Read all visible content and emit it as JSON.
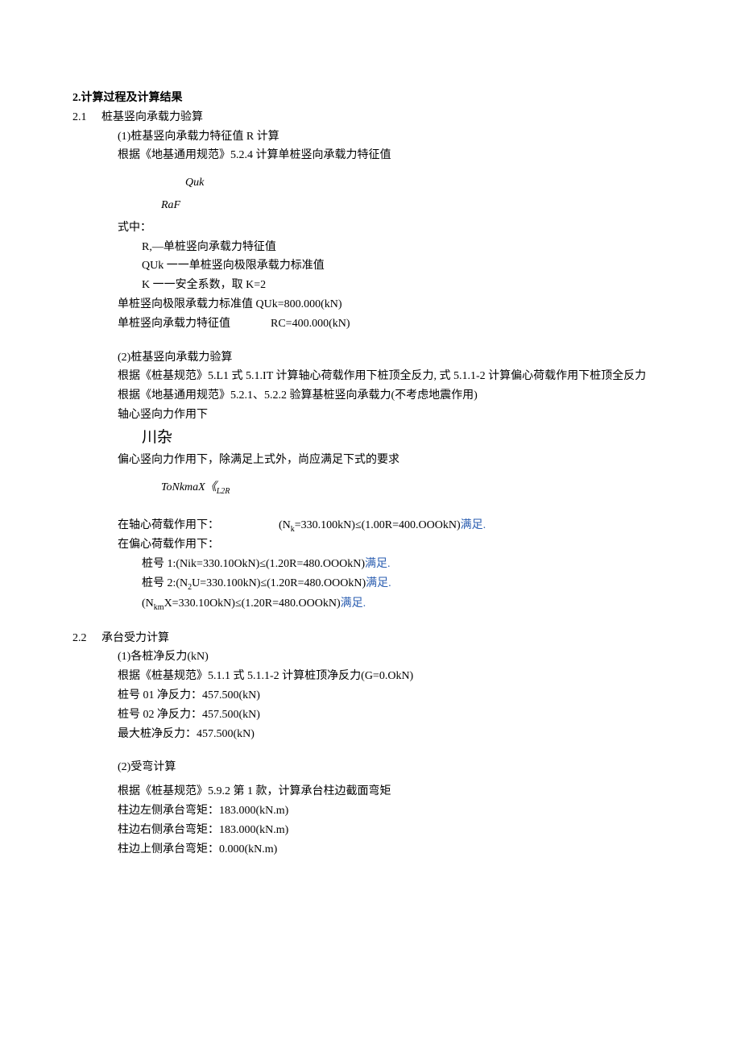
{
  "title": "2.计算过程及计算结果",
  "s21": {
    "num": "2.1",
    "title": "桩基竖向承载力验算",
    "p1": {
      "head": "(1)桩基竖向承载力特征值 R 计算",
      "basis": "根据《地基通用规范》5.2.4 计算单桩竖向承载力特征值",
      "f_top": "Quk",
      "f_bot": "RaF",
      "shi": "式中：",
      "v1": "R,—单桩竖向承载力特征值",
      "v2": "QUk 一一单桩竖向极限承载力标准值",
      "v3": "K 一一安全系数，取 K=2",
      "r1a": "单桩竖向极限承载力标准值 QUk=800.000(kN)",
      "r2a": "单桩竖向承载力特征值",
      "r2b": "RC=400.000(kN)"
    },
    "p2": {
      "head": "(2)桩基竖向承载力验算",
      "l1": "根据《桩基规范》5.L1 式 5.1.IT 计算轴心荷载作用下桩顶全反力, 式 5.1.1-2 计算偏心荷载作用下桩顶全反力",
      "l2": "根据《地基通用规范》5.2.1、5.2.2 验算基桩竖向承载力(不考虑地震作用)",
      "l3": "轴心竖向力作用下",
      "f1": "川杂",
      "l4": "偏心竖向力作用下，除满足上式外，尚应满足下式的要求",
      "f2a": "ToNkmaX《",
      "f2b": "L2R",
      "ax_lab": "在轴心荷载作用下：",
      "ax_v1": "(N",
      "ax_v1_sub": "k",
      "ax_v1_tail": "=330.100kN)≤(1.00R=400.OOOkN)",
      "ec_lab": "在偏心荷载作用下：",
      "p_1a": "桩号 1:(Nik=330.10OkN)≤(1.20R=480.OOOkN)",
      "p_2a": "桩号 2:(N",
      "p_2s": "2",
      "p_2b": "U=330.100kN)≤(1.20R=480.OOOkN)",
      "p_3a": "(N",
      "p_3s": "km",
      "p_3b": "X=330.10OkN)≤(1.20R=480.OOOkN)",
      "sat": "满足."
    }
  },
  "s22": {
    "num": "2.2",
    "title": "承台受力计算",
    "p1": {
      "head": "(1)各桩净反力(kN)",
      "l1": "根据《桩基规范》5.1.1 式 5.1.1-2 计算桩顶净反力(G=0.OkN)",
      "l2": "桩号 01 净反力：457.500(kN)",
      "l3": "桩号 02 净反力：457.500(kN)",
      "l4": "最大桩净反力：457.500(kN)"
    },
    "p2": {
      "head": "(2)受弯计算",
      "l1": "根据《桩基规范》5.9.2 第 1 款，计算承台柱边截面弯矩",
      "l2": "柱边左侧承台弯矩：183.000(kN.m)",
      "l3": "柱边右侧承台弯矩：183.000(kN.m)",
      "l4": "柱边上侧承台弯矩：0.000(kN.m)"
    }
  }
}
